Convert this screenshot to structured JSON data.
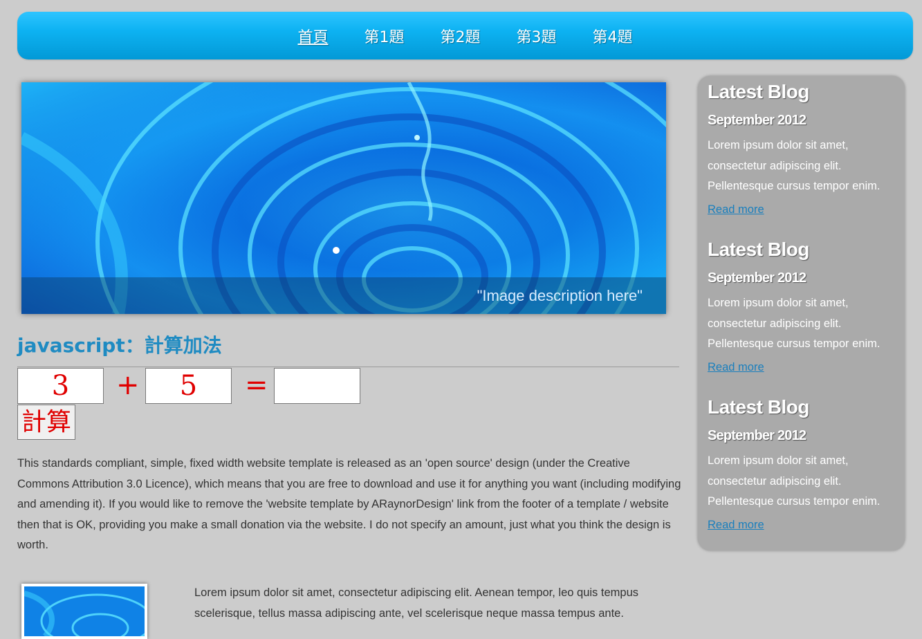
{
  "nav": {
    "items": [
      {
        "label": "首頁",
        "active": true
      },
      {
        "label": "第1題",
        "active": false
      },
      {
        "label": "第2題",
        "active": false
      },
      {
        "label": "第3題",
        "active": false
      },
      {
        "label": "第4題",
        "active": false
      }
    ]
  },
  "banner": {
    "caption": "\"Image description here\""
  },
  "main": {
    "title": "javascript：計算加法",
    "calculator": {
      "operand1": "3",
      "plus": "+",
      "operand2": "5",
      "equals": "=",
      "result": "",
      "button_label": "計算"
    },
    "paragraph": "This standards compliant, simple, fixed width website template is released as an 'open source' design (under the Creative Commons Attribution 3.0 Licence), which means that you are free to download and use it for anything you want (including modifying and amending it). If you would like to remove the 'website template by ARaynorDesign' link from the footer of a template / website then that is OK, providing you make a small donation via the website. I do not specify an amount, just what you think the design is worth.",
    "paragraph2": "Lorem ipsum dolor sit amet, consectetur adipiscing elit. Aenean tempor, leo quis tempus scelerisque, tellus massa adipiscing ante, vel scelerisque neque massa tempus ante."
  },
  "sidebar": {
    "blogs": [
      {
        "title": "Latest Blog",
        "date": "September 2012",
        "text": "Lorem ipsum dolor sit amet, consectetur adipiscing elit. Pellentesque cursus tempor enim.",
        "link": "Read more"
      },
      {
        "title": "Latest Blog",
        "date": "September 2012",
        "text": "Lorem ipsum dolor sit amet, consectetur adipiscing elit. Pellentesque cursus tempor enim.",
        "link": "Read more"
      },
      {
        "title": "Latest Blog",
        "date": "September 2012",
        "text": "Lorem ipsum dolor sit amet, consectetur adipiscing elit. Pellentesque cursus tempor enim.",
        "link": "Read more"
      }
    ]
  },
  "colors": {
    "background": "#cccccc",
    "nav_blue": "#0db2f2",
    "title_blue": "#1f8bc2",
    "calc_red": "#e00000",
    "sidebar_gray": "#aaaaaa",
    "link_blue": "#1a7fbd"
  }
}
